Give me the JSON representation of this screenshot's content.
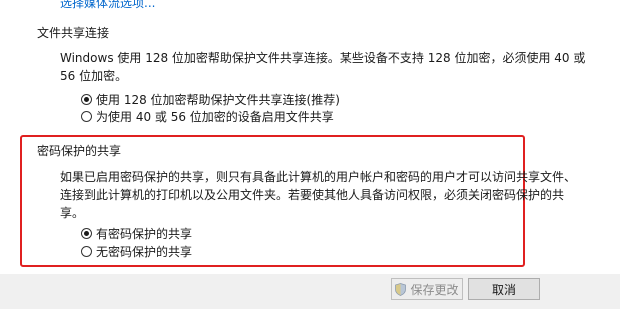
{
  "top_link": "选择媒体流选项...",
  "file_sharing": {
    "title": "文件共享连接",
    "description_line1": "Windows 使用 128 位加密帮助保护文件共享连接。某些设备不支持 128 位加密，必须使用 40 或",
    "description_line2": "56 位加密。",
    "options": [
      {
        "label": "使用 128 位加密帮助保护文件共享连接(推荐)",
        "checked": true
      },
      {
        "label": "为使用 40 或 56 位加密的设备启用文件共享",
        "checked": false
      }
    ]
  },
  "password_sharing": {
    "title": "密码保护的共享",
    "description_line1": "如果已启用密码保护的共享，则只有具备此计算机的用户帐户和密码的用户才可以访问共享文件、",
    "description_line2": "连接到此计算机的打印机以及公用文件夹。若要使其他人具备访问权限，必须关闭密码保护的共",
    "description_line3": "享。",
    "options": [
      {
        "label": "有密码保护的共享",
        "checked": true
      },
      {
        "label": "无密码保护的共享",
        "checked": false
      }
    ]
  },
  "footer": {
    "save_label": "保存更改",
    "cancel_label": "取消"
  },
  "colors": {
    "highlight": "#e02020",
    "link": "#0066cc"
  }
}
